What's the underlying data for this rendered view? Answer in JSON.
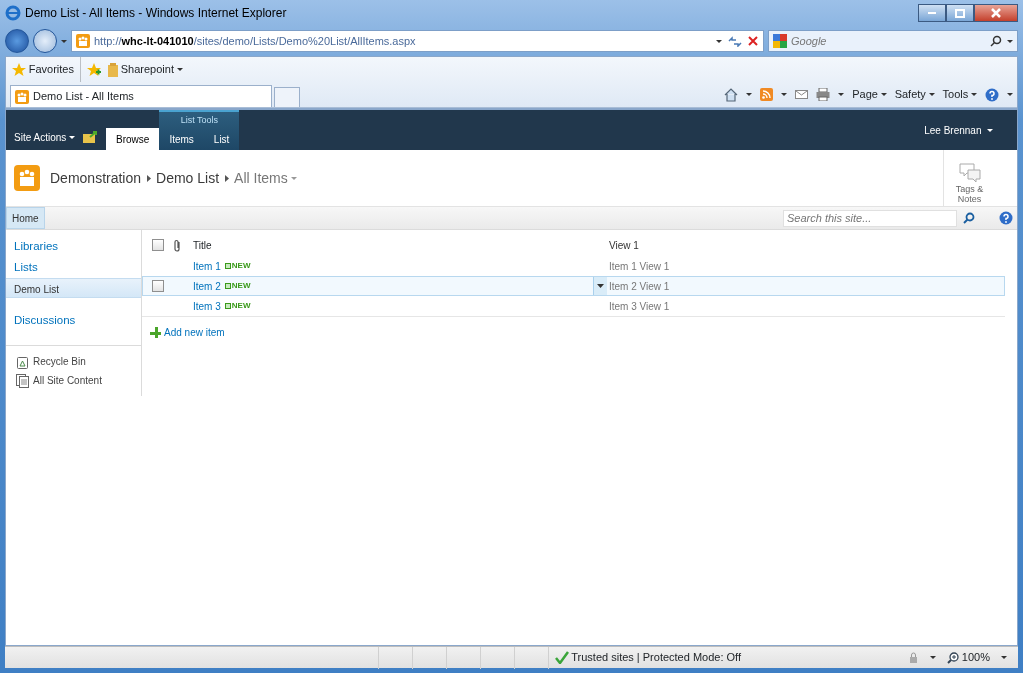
{
  "window": {
    "title": "Demo List - All Items - Windows Internet Explorer"
  },
  "address_bar": {
    "url": "http://**whc-lt-041010**/sites/demo/Lists/Demo%20List/AllItems.aspx",
    "search_placeholder": "Google"
  },
  "favorites_bar": {
    "label": "Favorites",
    "links": [
      "Sharepoint"
    ]
  },
  "browser_tabs": [
    {
      "label": "Demo List - All Items",
      "selected": true
    }
  ],
  "command_bar": [
    "Page",
    "Safety",
    "Tools"
  ],
  "ribbon": {
    "site_actions": "Site Actions",
    "context_group": "List Tools",
    "tabs": [
      {
        "label": "Browse",
        "selected": true
      },
      {
        "label": "Items",
        "selected": false
      },
      {
        "label": "List",
        "selected": false
      }
    ],
    "user": "Lee Brennan"
  },
  "breadcrumb": [
    "Demonstration",
    "Demo List",
    "All Items"
  ],
  "tags_notes": "Tags & Notes",
  "top_nav": [
    {
      "label": "Home",
      "selected": true
    }
  ],
  "site_search": {
    "placeholder": "Search this site..."
  },
  "quick_launch": {
    "items": [
      {
        "label": "Libraries",
        "kind": "heading",
        "selected": false
      },
      {
        "label": "Lists",
        "kind": "heading",
        "selected": false
      },
      {
        "label": "Demo List",
        "kind": "link",
        "selected": true
      },
      {
        "label": "Discussions",
        "kind": "heading",
        "selected": false
      }
    ],
    "footer": [
      {
        "label": "Recycle Bin",
        "kind": "bin"
      },
      {
        "label": "All Site Content",
        "kind": "pages"
      }
    ]
  },
  "list": {
    "select_all_checked": false,
    "columns": [
      "Title",
      "View 1"
    ],
    "rows": [
      {
        "title": "Item 1",
        "badge": "NEW",
        "view_1": "Item 1 View 1",
        "selected": false,
        "checked": false
      },
      {
        "title": "Item 2",
        "badge": "NEW",
        "view_1": "Item 2 View 1",
        "selected": true,
        "checked": false
      },
      {
        "title": "Item 3",
        "badge": "NEW",
        "view_1": "Item 3 View 1",
        "selected": false,
        "checked": false
      }
    ],
    "add_new": "Add new item"
  },
  "status_bar": {
    "security": "Trusted sites | Protected Mode: Off",
    "zoom": "100%"
  }
}
